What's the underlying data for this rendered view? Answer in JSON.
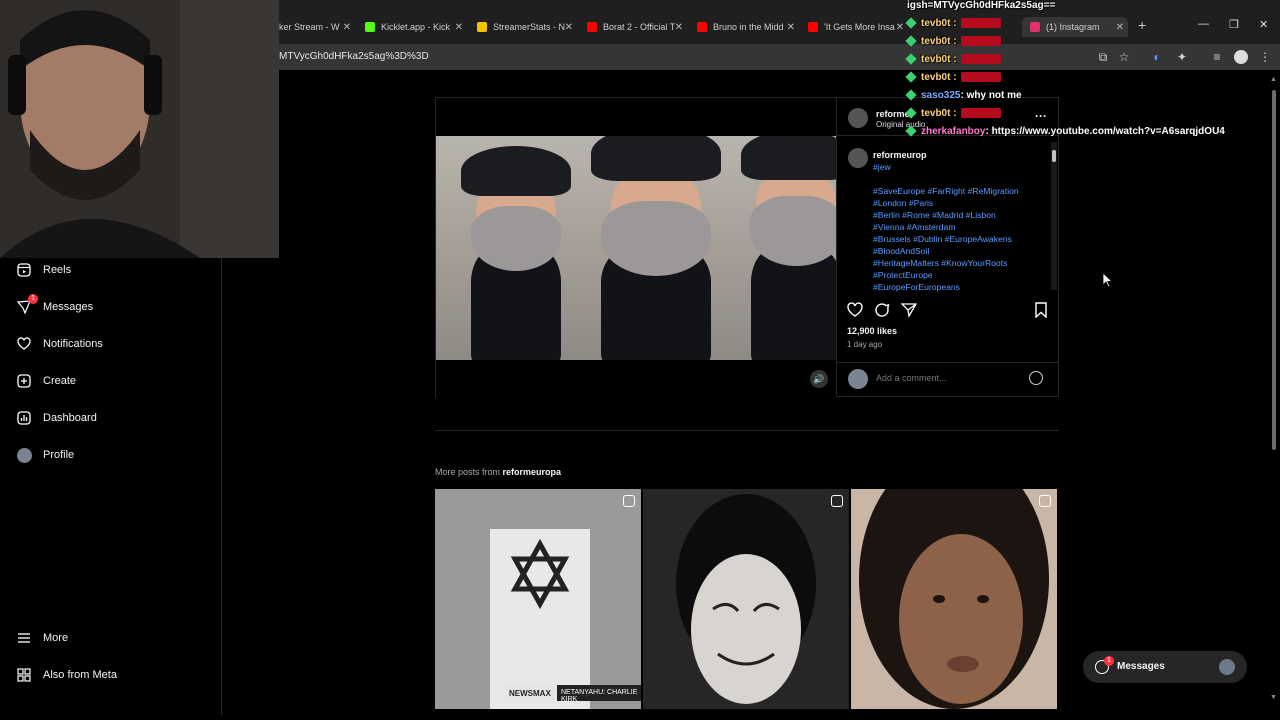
{
  "browser": {
    "tabs": [
      {
        "label": "ker Stream - W",
        "color": "#3a3a3a"
      },
      {
        "label": "Kicklet.app - Kick",
        "color": "#53fc18"
      },
      {
        "label": "StreamerStats - N",
        "color": "#f3c200"
      },
      {
        "label": "Borat 2 - Official T",
        "color": "#ff0000"
      },
      {
        "label": "Bruno in the Midd",
        "color": "#ff0000"
      },
      {
        "label": "'It Gets More Insa",
        "color": "#ff0000"
      },
      {
        "label": "(1) Instagram",
        "color": "#e1306c"
      }
    ],
    "url": "MTVycGh0dHFka2s5ag%3D%3D"
  },
  "sidebar": {
    "items": [
      {
        "label": "Reels",
        "icon": "reels-icon"
      },
      {
        "label": "Messages",
        "icon": "messages-icon",
        "badge": "1"
      },
      {
        "label": "Notifications",
        "icon": "heart-icon"
      },
      {
        "label": "Create",
        "icon": "plus-icon"
      },
      {
        "label": "Dashboard",
        "icon": "dashboard-icon"
      },
      {
        "label": "Profile",
        "icon": "avatar-icon"
      }
    ],
    "bottom": [
      {
        "label": "More",
        "icon": "menu-icon"
      },
      {
        "label": "Also from Meta",
        "icon": "meta-icon"
      }
    ]
  },
  "post": {
    "author": "reforme",
    "subtitle": "Original audio",
    "caption_author": "reformeurop",
    "first_tag": "#jew",
    "hashtags": [
      "#SaveEurope #FarRight #ReMigration",
      "#London #Paris",
      "#Berlin #Rome #Madrid #Lisbon",
      "#Vienna #Amsterdam",
      "#Brussels #Dublin #EuropeAwakens",
      "#BloodAndSoil",
      "#HeritageMatters #KnowYourRoots",
      "#ProtectEurope",
      "#EuropeForEuropeans"
    ],
    "likes": "12,900 likes",
    "time_ago": "1 day ago",
    "comment_placeholder": "Add a comment..."
  },
  "more_posts": {
    "prefix": "More posts from ",
    "account": "reformeuropa",
    "thumb_captions": [
      "NEWSMAX",
      "NETANYAHU: CHARLIE KIRK"
    ]
  },
  "messages_pill": {
    "label": "Messages",
    "badge": "1"
  },
  "chat": {
    "top_line": "igsh=MTVycGh0dHFka2s5ag==",
    "lines": [
      {
        "user": "tevb0t :",
        "text": ""
      },
      {
        "user": "tevb0t :",
        "text": ""
      },
      {
        "user": "tevb0t :",
        "text": ""
      },
      {
        "user": "tevb0t :",
        "text": ""
      },
      {
        "user": "saso325",
        "text": ": why not me"
      },
      {
        "user": "tevb0t :",
        "text": ""
      },
      {
        "user": "zherkafanboy",
        "text": ": https://www.youtube.com/watch?v=A6sarqjdOU4"
      }
    ]
  },
  "colors": {
    "accent": "#0095f6",
    "link": "#5b9bff",
    "badge": "#ff3040"
  }
}
